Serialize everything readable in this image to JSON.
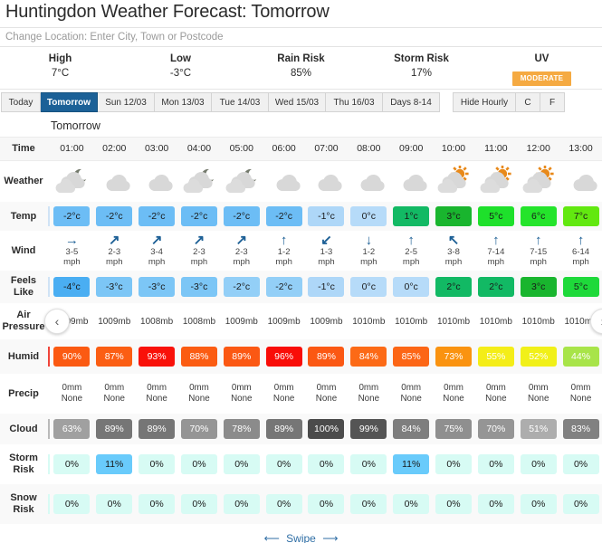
{
  "header": {
    "title": "Huntingdon Weather Forecast: Tomorrow"
  },
  "search": {
    "placeholder": "Change Location: Enter City, Town or Postcode",
    "value": ""
  },
  "summary": [
    {
      "label": "High",
      "value": "7°C"
    },
    {
      "label": "Low",
      "value": "-3°C"
    },
    {
      "label": "Rain Risk",
      "value": "85%"
    },
    {
      "label": "Storm Risk",
      "value": "17%"
    },
    {
      "label": "UV",
      "value": "MODERATE",
      "badge": true,
      "badge_color": "#f5aa42"
    }
  ],
  "tabs": {
    "days": [
      {
        "label": "Today",
        "active": false,
        "width": "narrow"
      },
      {
        "label": "Tomorrow",
        "active": true,
        "width": "wide"
      },
      {
        "label": "Sun 12/03",
        "active": false,
        "width": "wide"
      },
      {
        "label": "Mon 13/03",
        "active": false,
        "width": "wide"
      },
      {
        "label": "Tue 14/03",
        "active": false,
        "width": "wide"
      },
      {
        "label": "Wed 15/03",
        "active": false,
        "width": "wide"
      },
      {
        "label": "Thu 16/03",
        "active": false,
        "width": "wide"
      },
      {
        "label": "Days 8-14",
        "active": false,
        "width": "wide"
      }
    ],
    "controls": [
      {
        "label": "Hide Hourly",
        "kind": "hide"
      },
      {
        "label": "C",
        "kind": "unit"
      },
      {
        "label": "F",
        "kind": "unit"
      }
    ]
  },
  "day_heading": "Tomorrow",
  "row_labels": {
    "time": "Time",
    "weather": "Weather",
    "temp": "Temp",
    "wind": "Wind",
    "feels_like": "Feels Like",
    "air_pressure": "Air Pressure",
    "humid": "Humid",
    "precip": "Precip",
    "cloud": "Cloud",
    "storm_risk": "Storm Risk",
    "snow_risk": "Snow Risk"
  },
  "nav": {
    "prev": "‹",
    "next": "›"
  },
  "footer": {
    "swipe_label": "Swipe",
    "left_arrow": "⟵",
    "right_arrow": "⟶"
  },
  "chart_data": {
    "type": "table",
    "title": "Huntingdon Hourly Weather Forecast: Tomorrow",
    "times": [
      "01:00",
      "02:00",
      "03:00",
      "04:00",
      "05:00",
      "06:00",
      "07:00",
      "08:00",
      "09:00",
      "10:00",
      "11:00",
      "12:00",
      "13:00"
    ],
    "weather_icons": [
      "cloud-moon",
      "cloud",
      "cloud",
      "cloud-moon",
      "cloud-moon",
      "cloud",
      "cloud",
      "cloud",
      "cloud",
      "cloud-sun",
      "cloud-sun",
      "cloud-sun",
      "cloud"
    ],
    "temp": {
      "values": [
        "-2°c",
        "-2°c",
        "-2°c",
        "-2°c",
        "-2°c",
        "-2°c",
        "-1°c",
        "0°c",
        "1°c",
        "3°c",
        "5°c",
        "6°c",
        "7°c"
      ],
      "colors": [
        "#6cbdf5",
        "#6cbdf5",
        "#6cbdf5",
        "#6cbdf5",
        "#6cbdf5",
        "#6cbdf5",
        "#aed7f8",
        "#b6dbf9",
        "#12b964",
        "#19b52e",
        "#1ee02b",
        "#24e42b",
        "#62e810"
      ]
    },
    "wind": {
      "directions": [
        "→",
        "↗",
        "↗",
        "↗",
        "↗",
        "↑",
        "↙",
        "↓",
        "↑",
        "↖",
        "↑",
        "↑",
        "↑"
      ],
      "speeds": [
        "3-5 mph",
        "2-3 mph",
        "3-4 mph",
        "2-3 mph",
        "2-3 mph",
        "1-2 mph",
        "1-3 mph",
        "1-2 mph",
        "2-5 mph",
        "3-8 mph",
        "7-14 mph",
        "7-15 mph",
        "6-14 mph"
      ]
    },
    "feels_like": {
      "values": [
        "-4°c",
        "-3°c",
        "-3°c",
        "-3°c",
        "-2°c",
        "-2°c",
        "-1°c",
        "0°c",
        "0°c",
        "2°c",
        "2°c",
        "3°c",
        "5°c"
      ],
      "colors": [
        "#4aaef2",
        "#7cc6f6",
        "#7cc6f6",
        "#7cc6f6",
        "#93cff7",
        "#93cff7",
        "#aed7f8",
        "#b6dbf9",
        "#b6dbf9",
        "#12b964",
        "#12b964",
        "#19b52e",
        "#1ed93a"
      ]
    },
    "air_pressure": [
      "1009mb",
      "1009mb",
      "1008mb",
      "1008mb",
      "1009mb",
      "1009mb",
      "1009mb",
      "1010mb",
      "1010mb",
      "1010mb",
      "1010mb",
      "1010mb",
      "1010mb"
    ],
    "humidity": {
      "values": [
        "90%",
        "87%",
        "93%",
        "88%",
        "89%",
        "96%",
        "89%",
        "84%",
        "85%",
        "73%",
        "55%",
        "52%",
        "44%"
      ],
      "colors": [
        "#fb5a12",
        "#fb5e13",
        "#f91109",
        "#fb5c12",
        "#fb5813",
        "#f90d08",
        "#fb5813",
        "#fc6a16",
        "#fc6616",
        "#fa9310",
        "#f4ed18",
        "#f1f018",
        "#a8e449"
      ]
    },
    "precip": {
      "amounts": [
        "0mm",
        "0mm",
        "0mm",
        "0mm",
        "0mm",
        "0mm",
        "0mm",
        "0mm",
        "0mm",
        "0mm",
        "0mm",
        "0mm",
        "0mm"
      ],
      "types": [
        "None",
        "None",
        "None",
        "None",
        "None",
        "None",
        "None",
        "None",
        "None",
        "None",
        "None",
        "None",
        "None"
      ]
    },
    "cloud": {
      "values": [
        "63%",
        "89%",
        "89%",
        "70%",
        "78%",
        "89%",
        "100%",
        "99%",
        "84%",
        "75%",
        "70%",
        "51%",
        "83%"
      ],
      "colors": [
        "#a0a0a0",
        "#767676",
        "#767676",
        "#959595",
        "#8b8b8b",
        "#767676",
        "#4b4b4b",
        "#555555",
        "#7e7e7e",
        "#8f8f8f",
        "#959595",
        "#adadad",
        "#818181"
      ]
    },
    "storm_risk": {
      "values": [
        "0%",
        "11%",
        "0%",
        "0%",
        "0%",
        "0%",
        "0%",
        "0%",
        "11%",
        "0%",
        "0%",
        "0%",
        "0%"
      ],
      "colors": [
        "#d7fbf4",
        "#69cbfb",
        "#d7fbf4",
        "#d7fbf4",
        "#d7fbf4",
        "#d7fbf4",
        "#d7fbf4",
        "#d7fbf4",
        "#69cbfb",
        "#d7fbf4",
        "#d7fbf4",
        "#d7fbf4",
        "#d7fbf4"
      ]
    },
    "snow_risk": {
      "values": [
        "0%",
        "0%",
        "0%",
        "0%",
        "0%",
        "0%",
        "0%",
        "0%",
        "0%",
        "0%",
        "0%",
        "0%",
        "0%"
      ],
      "colors": [
        "#d7fbf4",
        "#d7fbf4",
        "#d7fbf4",
        "#d7fbf4",
        "#d7fbf4",
        "#d7fbf4",
        "#d7fbf4",
        "#d7fbf4",
        "#d7fbf4",
        "#d7fbf4",
        "#d7fbf4",
        "#d7fbf4",
        "#d7fbf4"
      ]
    }
  }
}
